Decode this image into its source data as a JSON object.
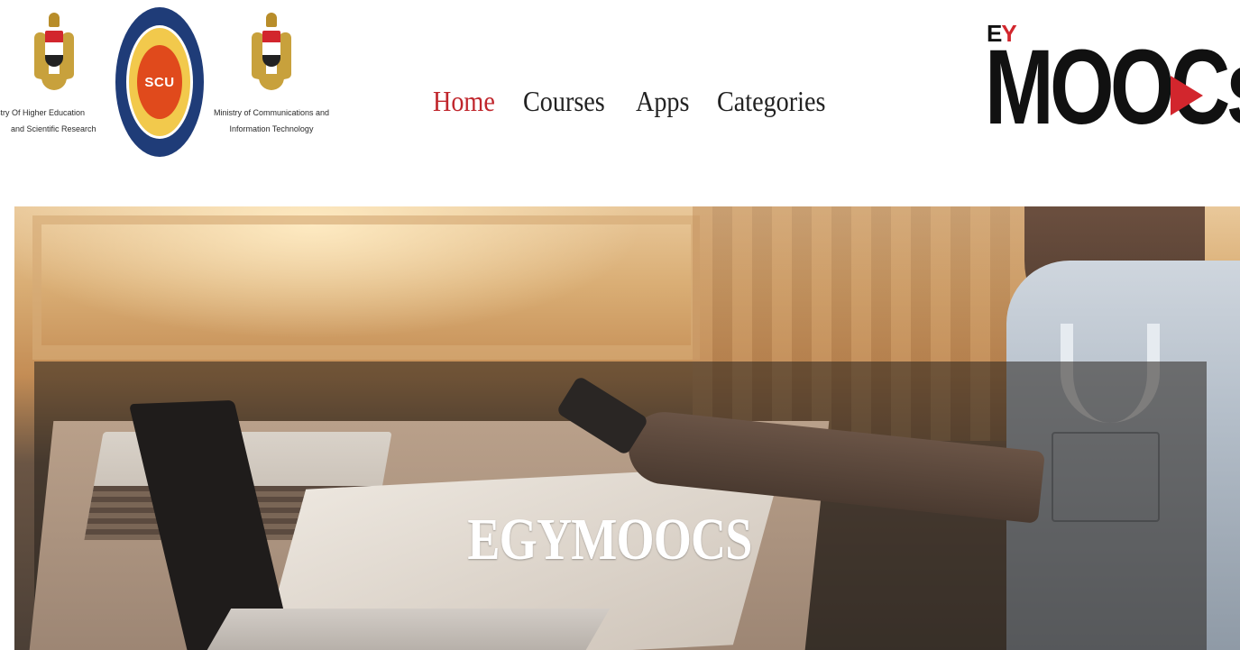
{
  "header": {
    "left_logos": {
      "ministry_higher_education": {
        "line1": "istry Of Higher Education",
        "line2": "and Scientific Research",
        "icon": "egypt-eagle-emblem"
      },
      "scu": {
        "text": "SCU",
        "icon": "scu-seal"
      },
      "ministry_communications": {
        "line1": "Ministry of Communications and",
        "line2": "Information Technology",
        "icon": "egypt-eagle-emblem"
      }
    },
    "nav": {
      "items": [
        {
          "label": "Home",
          "active": true
        },
        {
          "label": "Courses",
          "active": false
        },
        {
          "label": "Apps",
          "active": false
        },
        {
          "label": "Categories",
          "active": false
        }
      ]
    },
    "brand": {
      "prefix_e": "E",
      "prefix_y": "Y",
      "word": "MOOCs",
      "icon": "play-icon"
    }
  },
  "hero": {
    "title": "EGYMOOCS"
  },
  "colors": {
    "nav_active": "#c0262c",
    "nav_default": "#222222",
    "brand_red": "#d2262d",
    "scu_blue": "#1f3c78",
    "scu_orange": "#e04a1c",
    "emblem_gold": "#c8a13c"
  }
}
